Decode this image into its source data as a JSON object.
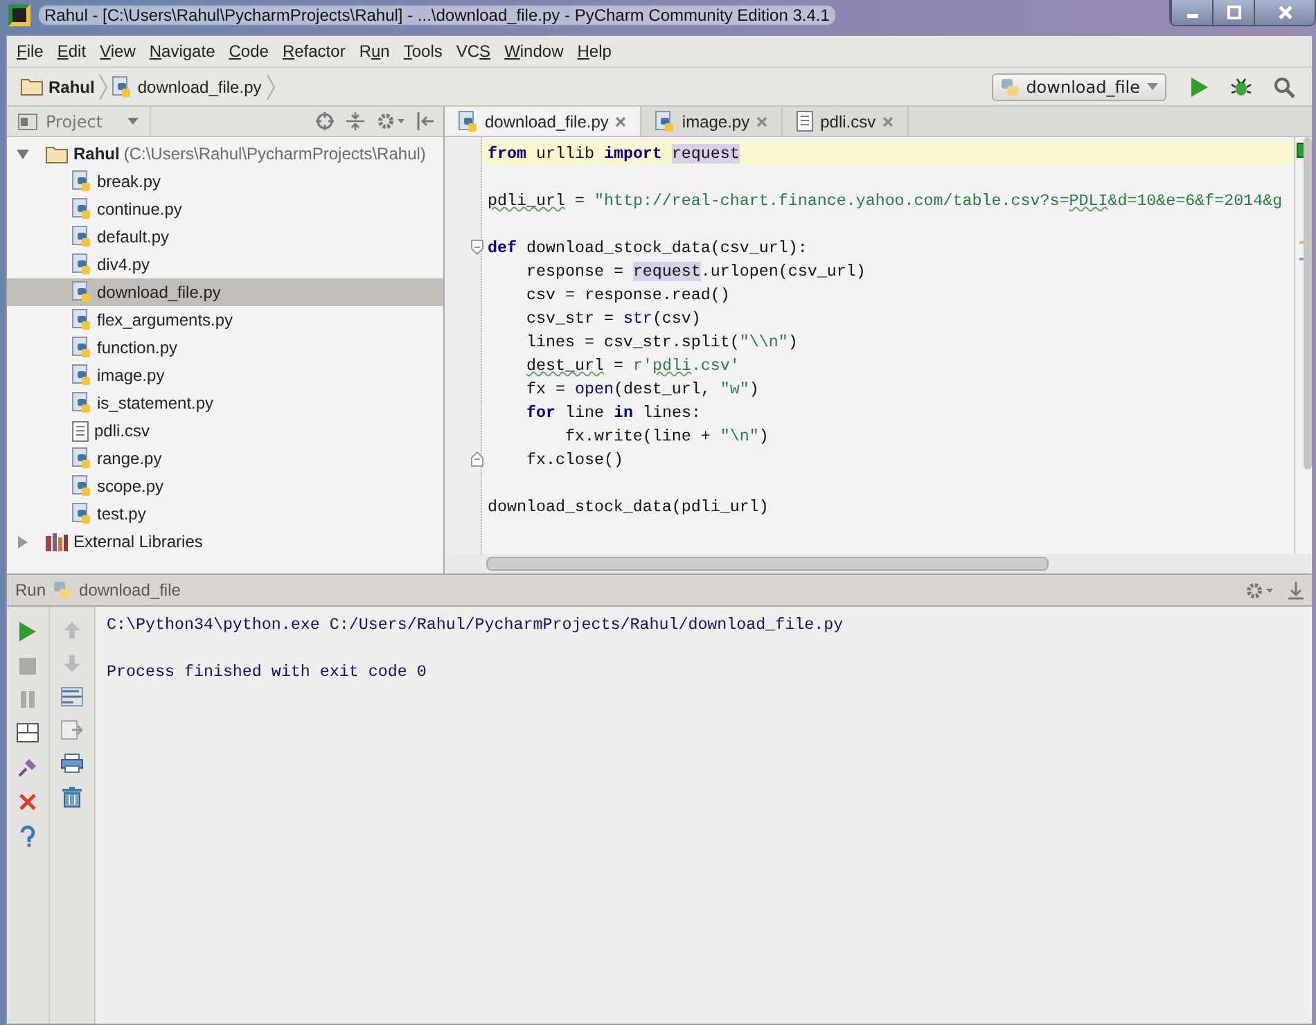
{
  "window": {
    "title": "Rahul - [C:\\Users\\Rahul\\PycharmProjects\\Rahul] - ...\\download_file.py - PyCharm Community Edition 3.4.1"
  },
  "menu": [
    {
      "key": "F",
      "rest": "ile"
    },
    {
      "key": "E",
      "rest": "dit"
    },
    {
      "key": "V",
      "rest": "iew"
    },
    {
      "key": "N",
      "rest": "avigate"
    },
    {
      "key": "C",
      "rest": "ode"
    },
    {
      "key": "R",
      "rest": "efactor"
    },
    {
      "lead": "R",
      "key": "u",
      "rest": "n"
    },
    {
      "key": "T",
      "rest": "ools"
    },
    {
      "lead": "VC",
      "key": "S"
    },
    {
      "key": "W",
      "rest": "indow"
    },
    {
      "key": "H",
      "rest": "elp"
    }
  ],
  "breadcrumbs": [
    {
      "label": "Rahul",
      "kind": "folder"
    },
    {
      "label": "download_file.py",
      "kind": "python"
    }
  ],
  "run_config": {
    "label": "download_file"
  },
  "project_panel": {
    "title": "Project",
    "tree": [
      {
        "label": "Rahul",
        "path": "(C:\\Users\\Rahul\\PycharmProjects\\Rahul)",
        "kind": "folder",
        "expanded": true,
        "selected": false,
        "children": [
          {
            "label": "break.py",
            "kind": "python",
            "selected": false
          },
          {
            "label": "continue.py",
            "kind": "python",
            "selected": false
          },
          {
            "label": "default.py",
            "kind": "python",
            "selected": false
          },
          {
            "label": "div4.py",
            "kind": "python",
            "selected": false
          },
          {
            "label": "download_file.py",
            "kind": "python",
            "selected": true
          },
          {
            "label": "flex_arguments.py",
            "kind": "python",
            "selected": false
          },
          {
            "label": "function.py",
            "kind": "python",
            "selected": false
          },
          {
            "label": "image.py",
            "kind": "python",
            "selected": false
          },
          {
            "label": "is_statement.py",
            "kind": "python",
            "selected": false
          },
          {
            "label": "pdli.csv",
            "kind": "text",
            "selected": false
          },
          {
            "label": "range.py",
            "kind": "python",
            "selected": false
          },
          {
            "label": "scope.py",
            "kind": "python",
            "selected": false
          },
          {
            "label": "test.py",
            "kind": "python",
            "selected": false
          }
        ]
      },
      {
        "label": "External Libraries",
        "kind": "library",
        "expanded": false,
        "selected": false
      }
    ]
  },
  "editor_tabs": [
    {
      "label": "download_file.py",
      "kind": "python",
      "selected": true
    },
    {
      "label": "image.py",
      "kind": "python",
      "selected": false
    },
    {
      "label": "pdli.csv",
      "kind": "text",
      "selected": false
    }
  ],
  "code": [
    {
      "current": true,
      "segments": [
        {
          "text": "from",
          "kind": "keyword"
        },
        {
          "text": " urllib ",
          "kind": "plain"
        },
        {
          "text": "import",
          "kind": "keyword"
        },
        {
          "text": " request",
          "kind": "reference"
        }
      ]
    },
    {
      "blank_before": true,
      "segments": [
        {
          "text": "pdli_url",
          "kind": "typo"
        },
        {
          "text": " = ",
          "kind": "plain"
        },
        {
          "text": "\"http://real-chart.finance.yahoo.com/table.csv?s=",
          "kind": "string"
        },
        {
          "text": "PDLI",
          "kind": "string_typo"
        },
        {
          "text": "&d=10&e=6&f=2014&g",
          "kind": "string"
        }
      ]
    },
    {
      "blank_before": true,
      "fold_start": true,
      "segments": [
        {
          "text": "def",
          "kind": "keyword"
        },
        {
          "text": " download_stock_data(csv_url):",
          "kind": "plain"
        }
      ]
    },
    {
      "segments": [
        {
          "text": "    response = ",
          "kind": "plain"
        },
        {
          "text": "request",
          "kind": "reference"
        },
        {
          "text": ".urlopen(csv_url)",
          "kind": "plain"
        }
      ]
    },
    {
      "segments": [
        {
          "text": "    csv = response.read()",
          "kind": "plain"
        }
      ]
    },
    {
      "segments": [
        {
          "text": "    csv_str = ",
          "kind": "plain"
        },
        {
          "text": "str",
          "kind": "builtin"
        },
        {
          "text": "(csv)",
          "kind": "plain"
        }
      ]
    },
    {
      "segments": [
        {
          "text": "    lines = csv_str.split(",
          "kind": "plain"
        },
        {
          "text": "\"\\\\n\"",
          "kind": "string"
        },
        {
          "text": ")",
          "kind": "plain"
        }
      ]
    },
    {
      "segments": [
        {
          "text": "    dest_url",
          "kind": "typo"
        },
        {
          "text": " = ",
          "kind": "plain"
        },
        {
          "text": "r'",
          "kind": "string"
        },
        {
          "text": "pdli",
          "kind": "string_typo"
        },
        {
          "text": ".csv'",
          "kind": "string"
        }
      ]
    },
    {
      "segments": [
        {
          "text": "    fx = ",
          "kind": "plain"
        },
        {
          "text": "open",
          "kind": "builtin"
        },
        {
          "text": "(dest_url, ",
          "kind": "plain"
        },
        {
          "text": "\"w\"",
          "kind": "string"
        },
        {
          "text": ")",
          "kind": "plain"
        }
      ]
    },
    {
      "segments": [
        {
          "text": "    for",
          "kind": "keyword"
        },
        {
          "text": " line ",
          "kind": "plain"
        },
        {
          "text": "in",
          "kind": "keyword"
        },
        {
          "text": " lines:",
          "kind": "plain"
        }
      ]
    },
    {
      "segments": [
        {
          "text": "        fx.write(line + ",
          "kind": "plain"
        },
        {
          "text": "\"\\n\"",
          "kind": "string"
        },
        {
          "text": ")",
          "kind": "plain"
        }
      ]
    },
    {
      "fold_end": true,
      "segments": [
        {
          "text": "    fx.close()",
          "kind": "plain"
        }
      ]
    },
    {
      "blank_before": true,
      "segments": [
        {
          "text": "download_stock_data(pdli_url)",
          "kind": "plain"
        }
      ]
    }
  ],
  "run_panel": {
    "title": "Run",
    "config": "download_file",
    "console": [
      {
        "text": "C:\\Python34\\python.exe C:/Users/Rahul/PycharmProjects/Rahul/download_file.py"
      },
      {
        "text": "Process finished with exit code 0",
        "blank_before": true
      }
    ]
  }
}
